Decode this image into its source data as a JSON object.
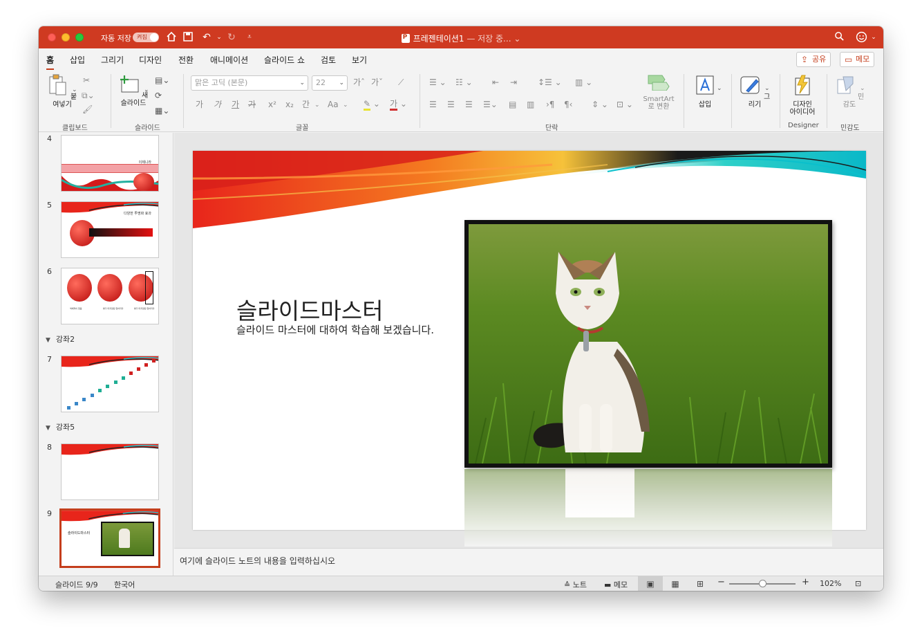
{
  "window": {
    "autosave_label": "자동 저장",
    "autosave_toggle": "켜짐",
    "doc_title": "프레젠테이션1",
    "doc_status": "— 저장 중...",
    "accent": "#cf3a21"
  },
  "tabs": [
    {
      "label": "홈",
      "active": true
    },
    {
      "label": "삽입"
    },
    {
      "label": "그리기"
    },
    {
      "label": "디자인"
    },
    {
      "label": "전환"
    },
    {
      "label": "애니메이션"
    },
    {
      "label": "슬라이드 쇼"
    },
    {
      "label": "검토"
    },
    {
      "label": "보기"
    }
  ],
  "share_label": "공유",
  "comment_label": "메모",
  "ribbon": {
    "paste_label": "붙여넣기",
    "new_slide_label": "새\n슬라이드",
    "font_name_placeholder": "맑은 고딕 (본문)",
    "font_size": "22",
    "smartart_label": "SmartArt\n로 변환",
    "insert_label": "삽입",
    "draw_label": "그리기",
    "design_ideas_label": "디자인\n아이디어",
    "sensitivity_label": "민감도",
    "groups": {
      "clipboard": "클립보드",
      "slides": "슬라이드",
      "font": "글꼴",
      "paragraph": "단락",
      "designer": "Designer",
      "sensitivity": "민감도"
    },
    "font_glyphs": {
      "bold": "가",
      "italic": "가",
      "underline": "가",
      "strike": "가",
      "superscript": "x²",
      "subscript": "x₂",
      "spacing": "간",
      "case": "Aa",
      "grow": "가ˆ",
      "shrink": "가ˇ"
    }
  },
  "thumbnails": [
    {
      "num": "4",
      "caption": "이제니라"
    },
    {
      "num": "5",
      "caption": "다양한 투명화 효과"
    },
    {
      "num": "6",
      "captions": [
        "색채적이 없음",
        "밝기 미지정된 없어지다",
        "밝기 미지정된 없어지다"
      ]
    },
    {
      "section": "강좌2"
    },
    {
      "num": "7"
    },
    {
      "section": "강좌5"
    },
    {
      "num": "8"
    },
    {
      "num": "9",
      "caption": "슬라이드마스터",
      "selected": true
    }
  ],
  "slide": {
    "title": "슬라이드마스터",
    "subtitle": "슬라이드 마스터에 대하여 학습해 보겠습니다."
  },
  "notes_placeholder": "여기에 슬라이드 노트의 내용을 입력하십시오",
  "status": {
    "slide_count": "슬라이드 9/9",
    "language": "한국어",
    "notes_label": "노트",
    "comments_label": "메모",
    "zoom_level": 0.5,
    "zoom": "102%"
  }
}
